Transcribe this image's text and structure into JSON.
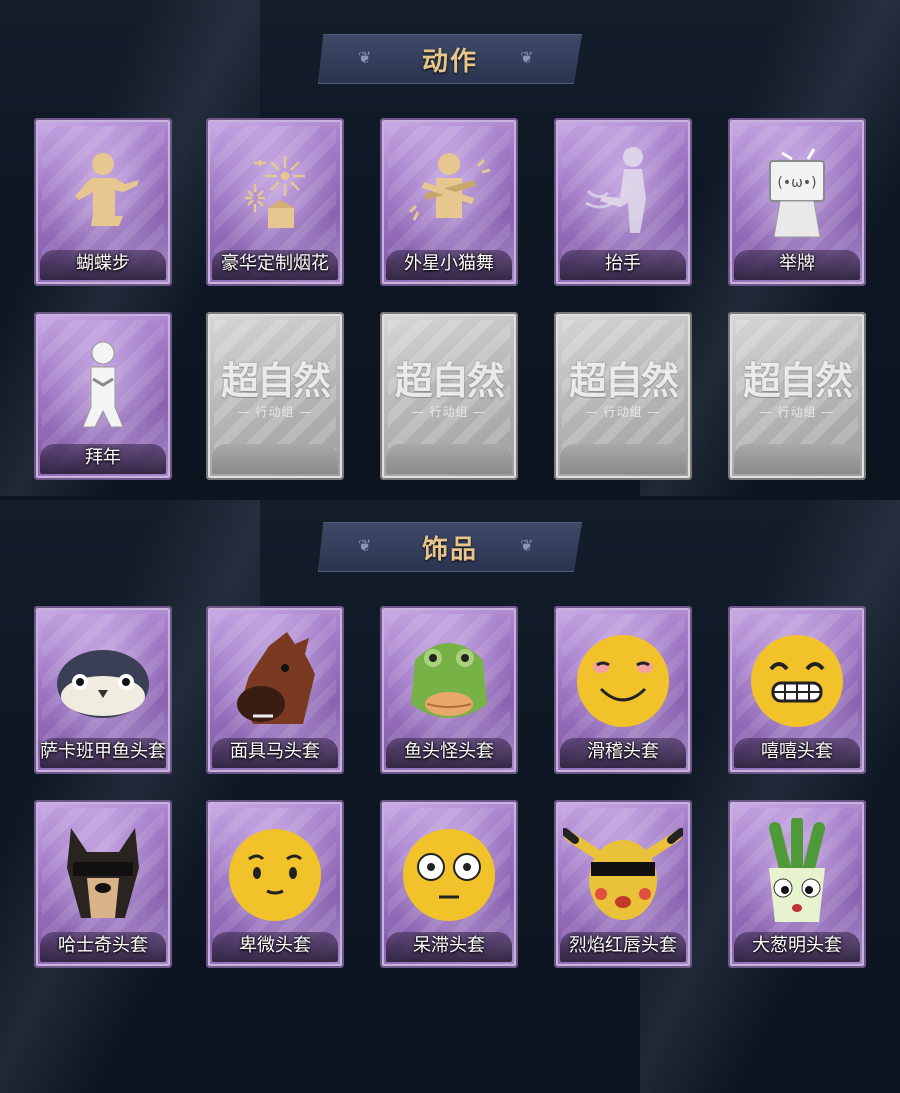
{
  "sections": [
    {
      "title": "动作",
      "items": [
        {
          "label": "蝴蝶步",
          "icon": "dancer-pose-icon",
          "locked": false
        },
        {
          "label": "豪华定制烟花",
          "icon": "fireworks-icon",
          "locked": false
        },
        {
          "label": "外星小猫舞",
          "icon": "dancer-arms-cross-icon",
          "locked": false
        },
        {
          "label": "抬手",
          "icon": "raise-hand-ghost-icon",
          "locked": false
        },
        {
          "label": "举牌",
          "icon": "hold-sign-icon",
          "locked": false
        },
        {
          "label": "拜年",
          "icon": "new-year-greeting-icon",
          "locked": false
        },
        {
          "label": "",
          "icon": "locked-placeholder",
          "locked": true
        },
        {
          "label": "",
          "icon": "locked-placeholder",
          "locked": true
        },
        {
          "label": "",
          "icon": "locked-placeholder",
          "locked": true
        },
        {
          "label": "",
          "icon": "locked-placeholder",
          "locked": true
        }
      ]
    },
    {
      "title": "饰品",
      "items": [
        {
          "label": "萨卡班甲鱼头套",
          "icon": "fish-head-mask-icon",
          "locked": false
        },
        {
          "label": "面具马头套",
          "icon": "horse-head-mask-icon",
          "locked": false
        },
        {
          "label": "鱼头怪头套",
          "icon": "frog-fish-mask-icon",
          "locked": false
        },
        {
          "label": "滑稽头套",
          "icon": "smirk-emoji-mask-icon",
          "locked": false
        },
        {
          "label": "嘻嘻头套",
          "icon": "grin-emoji-mask-icon",
          "locked": false
        },
        {
          "label": "哈士奇头套",
          "icon": "husky-sunglasses-mask-icon",
          "locked": false
        },
        {
          "label": "卑微头套",
          "icon": "shy-emoji-mask-icon",
          "locked": false
        },
        {
          "label": "呆滞头套",
          "icon": "dazed-emoji-mask-icon",
          "locked": false
        },
        {
          "label": "烈焰红唇头套",
          "icon": "pikachu-sunglasses-mask-icon",
          "locked": false
        },
        {
          "label": "大葱明头套",
          "icon": "scallion-mask-icon",
          "locked": false
        }
      ]
    }
  ],
  "locked_watermark": {
    "main": "超自然",
    "sub": "— 行动组 —"
  },
  "colors": {
    "background": "#0c1521",
    "title_text": "#e8c58a",
    "banner": "#2f3a58",
    "card_purple": "#a27bc7",
    "card_locked": "#b9b9b9"
  }
}
